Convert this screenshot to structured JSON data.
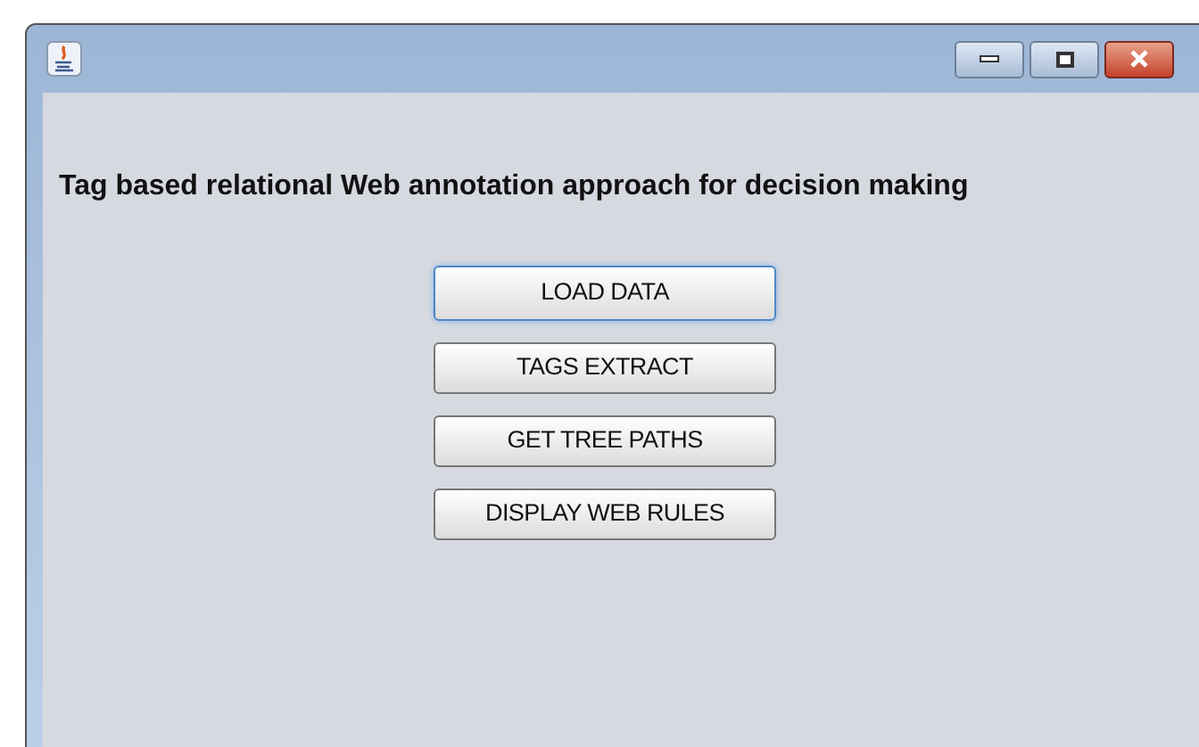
{
  "heading": "Tag based relational Web annotation approach for decision making",
  "buttons": [
    {
      "label": "LOAD DATA",
      "focused": true
    },
    {
      "label": "TAGS EXTRACT",
      "focused": false
    },
    {
      "label": "GET TREE PATHS",
      "focused": false
    },
    {
      "label": "DISPLAY WEB RULES",
      "focused": false
    }
  ]
}
